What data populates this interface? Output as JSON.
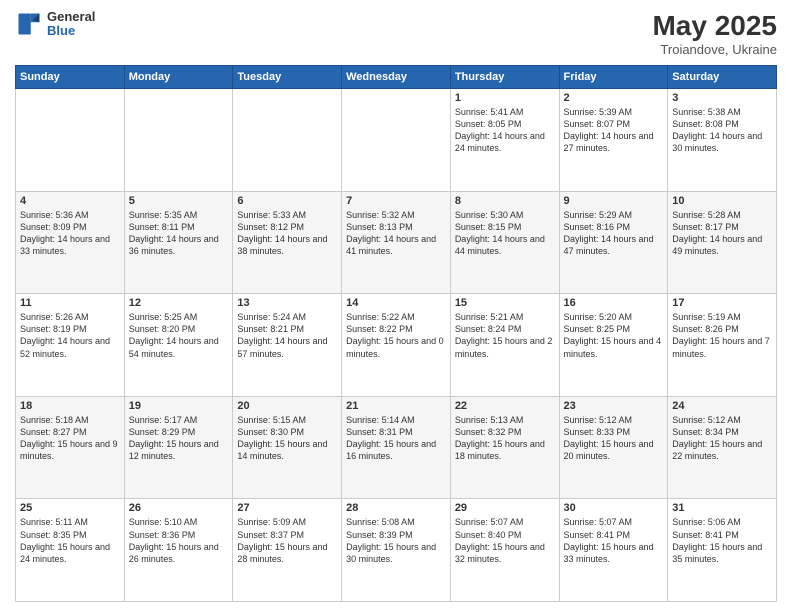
{
  "header": {
    "logo": {
      "general": "General",
      "blue": "Blue"
    },
    "title": "May 2025",
    "location": "Troiandove, Ukraine"
  },
  "weekdays": [
    "Sunday",
    "Monday",
    "Tuesday",
    "Wednesday",
    "Thursday",
    "Friday",
    "Saturday"
  ],
  "weeks": [
    [
      {
        "day": "",
        "sunrise": "",
        "sunset": "",
        "daylight": ""
      },
      {
        "day": "",
        "sunrise": "",
        "sunset": "",
        "daylight": ""
      },
      {
        "day": "",
        "sunrise": "",
        "sunset": "",
        "daylight": ""
      },
      {
        "day": "",
        "sunrise": "",
        "sunset": "",
        "daylight": ""
      },
      {
        "day": "1",
        "sunrise": "Sunrise: 5:41 AM",
        "sunset": "Sunset: 8:05 PM",
        "daylight": "Daylight: 14 hours and 24 minutes."
      },
      {
        "day": "2",
        "sunrise": "Sunrise: 5:39 AM",
        "sunset": "Sunset: 8:07 PM",
        "daylight": "Daylight: 14 hours and 27 minutes."
      },
      {
        "day": "3",
        "sunrise": "Sunrise: 5:38 AM",
        "sunset": "Sunset: 8:08 PM",
        "daylight": "Daylight: 14 hours and 30 minutes."
      }
    ],
    [
      {
        "day": "4",
        "sunrise": "Sunrise: 5:36 AM",
        "sunset": "Sunset: 8:09 PM",
        "daylight": "Daylight: 14 hours and 33 minutes."
      },
      {
        "day": "5",
        "sunrise": "Sunrise: 5:35 AM",
        "sunset": "Sunset: 8:11 PM",
        "daylight": "Daylight: 14 hours and 36 minutes."
      },
      {
        "day": "6",
        "sunrise": "Sunrise: 5:33 AM",
        "sunset": "Sunset: 8:12 PM",
        "daylight": "Daylight: 14 hours and 38 minutes."
      },
      {
        "day": "7",
        "sunrise": "Sunrise: 5:32 AM",
        "sunset": "Sunset: 8:13 PM",
        "daylight": "Daylight: 14 hours and 41 minutes."
      },
      {
        "day": "8",
        "sunrise": "Sunrise: 5:30 AM",
        "sunset": "Sunset: 8:15 PM",
        "daylight": "Daylight: 14 hours and 44 minutes."
      },
      {
        "day": "9",
        "sunrise": "Sunrise: 5:29 AM",
        "sunset": "Sunset: 8:16 PM",
        "daylight": "Daylight: 14 hours and 47 minutes."
      },
      {
        "day": "10",
        "sunrise": "Sunrise: 5:28 AM",
        "sunset": "Sunset: 8:17 PM",
        "daylight": "Daylight: 14 hours and 49 minutes."
      }
    ],
    [
      {
        "day": "11",
        "sunrise": "Sunrise: 5:26 AM",
        "sunset": "Sunset: 8:19 PM",
        "daylight": "Daylight: 14 hours and 52 minutes."
      },
      {
        "day": "12",
        "sunrise": "Sunrise: 5:25 AM",
        "sunset": "Sunset: 8:20 PM",
        "daylight": "Daylight: 14 hours and 54 minutes."
      },
      {
        "day": "13",
        "sunrise": "Sunrise: 5:24 AM",
        "sunset": "Sunset: 8:21 PM",
        "daylight": "Daylight: 14 hours and 57 minutes."
      },
      {
        "day": "14",
        "sunrise": "Sunrise: 5:22 AM",
        "sunset": "Sunset: 8:22 PM",
        "daylight": "Daylight: 15 hours and 0 minutes."
      },
      {
        "day": "15",
        "sunrise": "Sunrise: 5:21 AM",
        "sunset": "Sunset: 8:24 PM",
        "daylight": "Daylight: 15 hours and 2 minutes."
      },
      {
        "day": "16",
        "sunrise": "Sunrise: 5:20 AM",
        "sunset": "Sunset: 8:25 PM",
        "daylight": "Daylight: 15 hours and 4 minutes."
      },
      {
        "day": "17",
        "sunrise": "Sunrise: 5:19 AM",
        "sunset": "Sunset: 8:26 PM",
        "daylight": "Daylight: 15 hours and 7 minutes."
      }
    ],
    [
      {
        "day": "18",
        "sunrise": "Sunrise: 5:18 AM",
        "sunset": "Sunset: 8:27 PM",
        "daylight": "Daylight: 15 hours and 9 minutes."
      },
      {
        "day": "19",
        "sunrise": "Sunrise: 5:17 AM",
        "sunset": "Sunset: 8:29 PM",
        "daylight": "Daylight: 15 hours and 12 minutes."
      },
      {
        "day": "20",
        "sunrise": "Sunrise: 5:15 AM",
        "sunset": "Sunset: 8:30 PM",
        "daylight": "Daylight: 15 hours and 14 minutes."
      },
      {
        "day": "21",
        "sunrise": "Sunrise: 5:14 AM",
        "sunset": "Sunset: 8:31 PM",
        "daylight": "Daylight: 15 hours and 16 minutes."
      },
      {
        "day": "22",
        "sunrise": "Sunrise: 5:13 AM",
        "sunset": "Sunset: 8:32 PM",
        "daylight": "Daylight: 15 hours and 18 minutes."
      },
      {
        "day": "23",
        "sunrise": "Sunrise: 5:12 AM",
        "sunset": "Sunset: 8:33 PM",
        "daylight": "Daylight: 15 hours and 20 minutes."
      },
      {
        "day": "24",
        "sunrise": "Sunrise: 5:12 AM",
        "sunset": "Sunset: 8:34 PM",
        "daylight": "Daylight: 15 hours and 22 minutes."
      }
    ],
    [
      {
        "day": "25",
        "sunrise": "Sunrise: 5:11 AM",
        "sunset": "Sunset: 8:35 PM",
        "daylight": "Daylight: 15 hours and 24 minutes."
      },
      {
        "day": "26",
        "sunrise": "Sunrise: 5:10 AM",
        "sunset": "Sunset: 8:36 PM",
        "daylight": "Daylight: 15 hours and 26 minutes."
      },
      {
        "day": "27",
        "sunrise": "Sunrise: 5:09 AM",
        "sunset": "Sunset: 8:37 PM",
        "daylight": "Daylight: 15 hours and 28 minutes."
      },
      {
        "day": "28",
        "sunrise": "Sunrise: 5:08 AM",
        "sunset": "Sunset: 8:39 PM",
        "daylight": "Daylight: 15 hours and 30 minutes."
      },
      {
        "day": "29",
        "sunrise": "Sunrise: 5:07 AM",
        "sunset": "Sunset: 8:40 PM",
        "daylight": "Daylight: 15 hours and 32 minutes."
      },
      {
        "day": "30",
        "sunrise": "Sunrise: 5:07 AM",
        "sunset": "Sunset: 8:41 PM",
        "daylight": "Daylight: 15 hours and 33 minutes."
      },
      {
        "day": "31",
        "sunrise": "Sunrise: 5:06 AM",
        "sunset": "Sunset: 8:41 PM",
        "daylight": "Daylight: 15 hours and 35 minutes."
      }
    ]
  ]
}
